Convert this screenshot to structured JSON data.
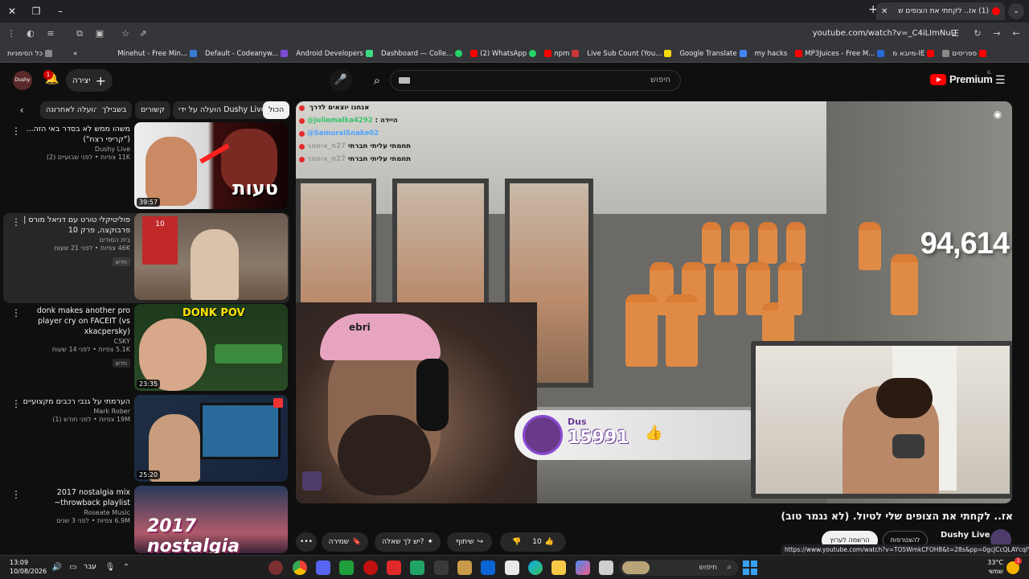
{
  "browser": {
    "tab_title": "(1) אז.. לקחתי את הצופים ש",
    "url": "youtube.com/watch?v=_C4iLImNuU",
    "bookmarks": [
      {
        "label": "כל הסימניות",
        "color": "#888888"
      },
      {
        "label": "Minehut - Free Min...",
        "color": "#3a7bd5"
      },
      {
        "label": "Default - Codeanyw...",
        "color": "#7a4bd8"
      },
      {
        "label": "Android Developers",
        "color": "#3ddc84"
      },
      {
        "label": "Dashboard — Colle...",
        "color": "#25d366"
      },
      {
        "label": "(2) WhatsApp",
        "color": "#25d366"
      },
      {
        "label": "npm",
        "color": "#cb3837"
      },
      {
        "label": "Live Sub Count (You...",
        "color": "#f5d90a"
      },
      {
        "label": "Google Translate",
        "color": "#4285f4"
      },
      {
        "label": "my hacks",
        "color": "#ff0000"
      },
      {
        "label": "MP3Juices - Free M...",
        "color": "#2a6ad8"
      },
      {
        "label": "מיובא מ-IE",
        "color": "#cc0000"
      },
      {
        "label": "ספריסים",
        "color": "#888888"
      }
    ]
  },
  "header": {
    "create_label": "יצירה",
    "notification_count": "1",
    "search_placeholder": "חיפוש",
    "logo_text": "Premium",
    "logo_sup": "IL",
    "avatar_text": "Dushy"
  },
  "chips": {
    "all": "הכול",
    "by_uploader": "הועלה על ידי Dushy Live",
    "related": "קשורים",
    "for_you": "בשבילך",
    "recent": "הועלה לאחרונה"
  },
  "recommendations": [
    {
      "title": "משהו ממש לא בסדר באי הזה... (\"קריפי רצח\")",
      "channel": "Dushy Live",
      "stats": "11K צפיות • לפני שבועיים (2)",
      "badge": "",
      "duration": "39:57",
      "thumb_text": "טעות"
    },
    {
      "title": "פוליטיקלי טורט עם דניאל מורס | פרבוקצה, פרק 10",
      "channel": "בית הסודים",
      "stats": "46K צפיות • לפני 21 שעות",
      "badge": "חדש",
      "duration": "",
      "thumb_text": "10"
    },
    {
      "title": "donk makes another pro player cry on FACEIT (vs xkacpersky)",
      "channel": "CSKY",
      "stats": "5.1K צפיות • לפני 14 שעות",
      "badge": "חדש",
      "duration": "23:35",
      "thumb_text": "DONK POV"
    },
    {
      "title": "הערמתי על גנבי רכבים מקצועיים",
      "channel": "Mark Rober",
      "stats": "19M צפיות • לפני חודש (1)",
      "badge": "",
      "duration": "25:20",
      "thumb_text": ""
    },
    {
      "title": "2017 nostalgia mix ~throwback playlist",
      "channel": "Roseate Music",
      "stats": "6.9M צפיות • לפני 3 שנים",
      "badge": "",
      "duration": "",
      "thumb_text": "2017 nostalgia"
    }
  ],
  "player": {
    "chat": [
      {
        "name": "",
        "message": "אנחנו יוצאים לדרך",
        "name_color": "gray"
      },
      {
        "name": "@juliemalka4292",
        "message": "היידה",
        "name_color": "green"
      },
      {
        "name": "@SamuraiSnake02",
        "message": "",
        "name_color": "blue"
      },
      {
        "name": "איתמר_n27",
        "message": "תחמתי עליתי חברתי",
        "name_color": "gray"
      },
      {
        "name": "איתמר_n27",
        "message": "תחמתי עליתי חברתי",
        "name_color": "gray"
      }
    ],
    "viewer_count": "94,614",
    "like_card_name": "Dus",
    "like_card_count": "15991",
    "cap_text": "ebri"
  },
  "video": {
    "title": "אז.. לקחתי את הצופים שלי לטיול. (לא נגמר טוב)",
    "channel": "Dushy Live",
    "subscribe_label": "הרשמה לערוץ",
    "join_label": "להצטרפות",
    "like_count": "10",
    "share_label": "שיתוף",
    "ask_label": "יש לך שאלה?",
    "save_label": "שמירה",
    "status_url": "https://www.youtube.com/watch?v=TO5WmkCFOH8&t=28s&pp=0gcJCcQLAYcqIYzv"
  },
  "taskbar": {
    "time": "13:09",
    "date": "10/08/2026",
    "lang": "עבר",
    "search_placeholder": "חיפוש",
    "temperature": "33°C",
    "weather_label": "שמשי",
    "weather_badge": "1"
  },
  "colors": {
    "accent": "#ff0000",
    "background": "#0f0f0f",
    "chip_bg": "#272727"
  }
}
